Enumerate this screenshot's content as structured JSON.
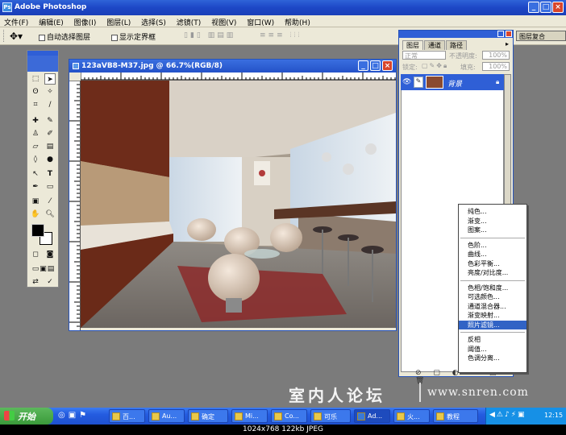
{
  "titlebar": {
    "title": "Adobe Photoshop",
    "min": "_",
    "max": "□",
    "close": "×"
  },
  "menu": [
    {
      "label": "文件(F)"
    },
    {
      "label": "编辑(E)"
    },
    {
      "label": "图像(I)"
    },
    {
      "label": "图层(L)"
    },
    {
      "label": "选择(S)"
    },
    {
      "label": "滤镜(T)"
    },
    {
      "label": "视图(V)"
    },
    {
      "label": "窗口(W)"
    },
    {
      "label": "帮助(H)"
    }
  ],
  "options": {
    "auto_select": "自动选择图层",
    "show_bounds": "显示定界框"
  },
  "document": {
    "title": "123aVB8-M37.jpg @ 66.7%(RGB/8)"
  },
  "layers_panel": {
    "tabs": [
      "图层",
      "通道",
      "路径"
    ],
    "blend_mode": "正常",
    "opacity_label": "不透明度:",
    "opacity_value": "100%",
    "lock_label": "锁定:",
    "fill_label": "填充:",
    "fill_value": "100%",
    "layer_name": "背景"
  },
  "side_tab": {
    "label": "图层复合"
  },
  "adjust_menu": {
    "group1": [
      "纯色...",
      "渐变...",
      "图案..."
    ],
    "group2": [
      "色阶...",
      "曲线...",
      "色彩平衡...",
      "亮度/对比度..."
    ],
    "group3": [
      "色相/饱和度...",
      "可选颜色...",
      "通道混合器...",
      "渐变映射...",
      "照片滤镜..."
    ],
    "group4": [
      "反相",
      "阈值...",
      "色调分离..."
    ],
    "selected": "照片滤镜..."
  },
  "watermark": {
    "cn": "室内人论坛",
    "url": "www.snren.com"
  },
  "taskbar": {
    "start": "开始",
    "tasks": [
      {
        "label": "百..."
      },
      {
        "label": "Au..."
      },
      {
        "label": "确定"
      },
      {
        "label": "Mi..."
      },
      {
        "label": "Co..."
      },
      {
        "label": "可乐"
      },
      {
        "label": "Ad..."
      },
      {
        "label": "火..."
      },
      {
        "label": "教程"
      }
    ],
    "clock": "12:15"
  },
  "caption": "1024x768 122kb JPEG"
}
